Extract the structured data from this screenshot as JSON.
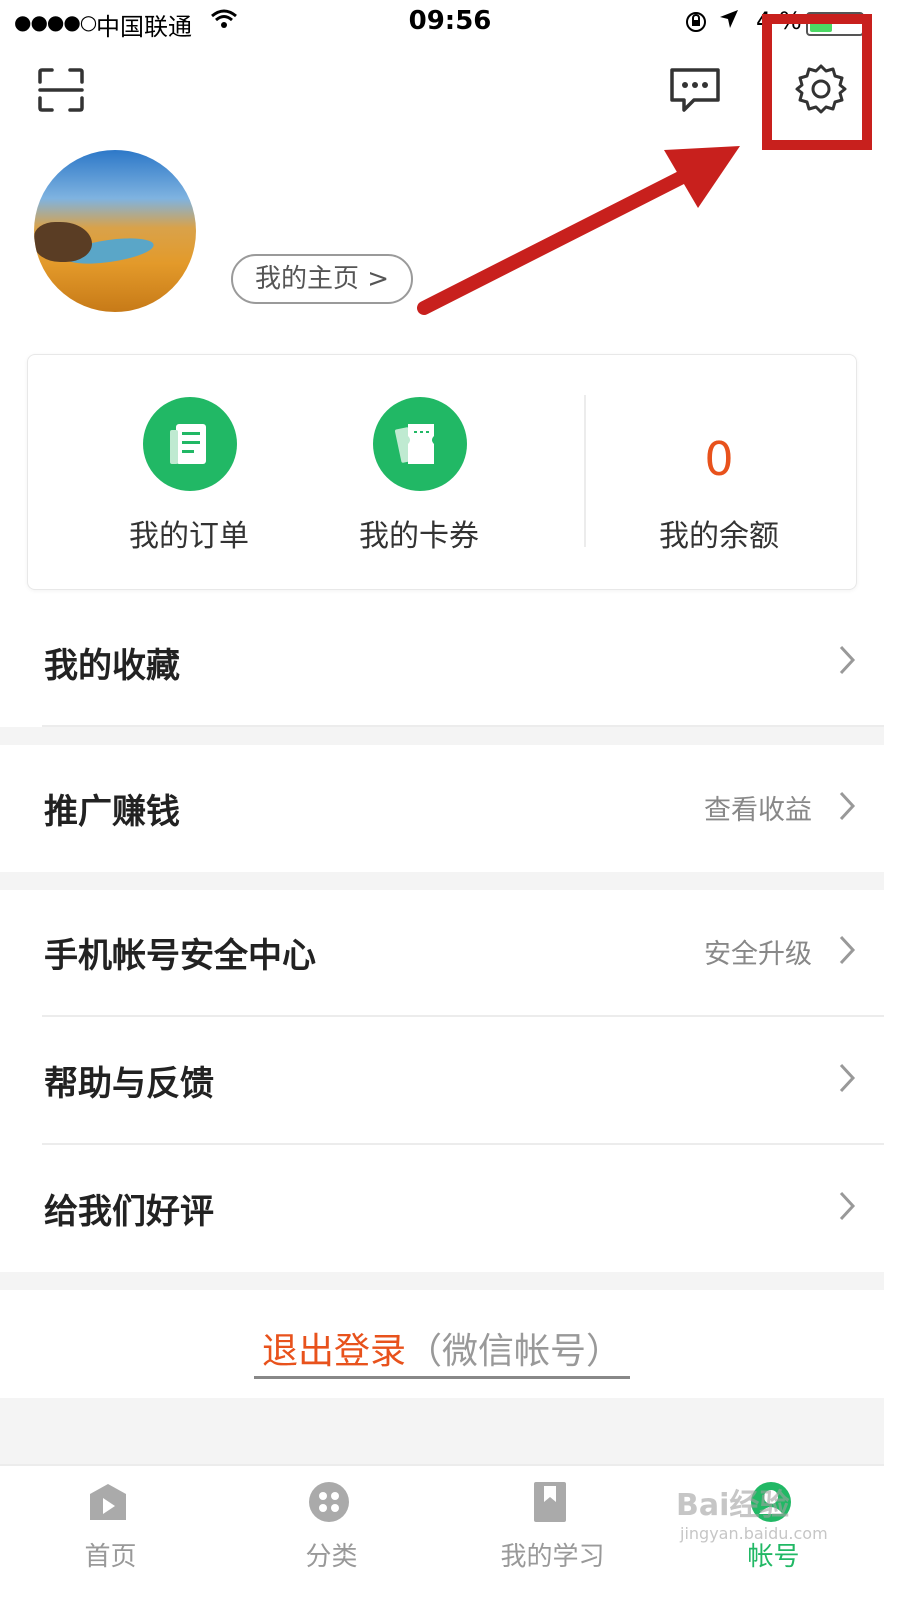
{
  "status_bar": {
    "signal": "●●●●○",
    "carrier": "中国联通",
    "time": "09:56",
    "battery_text": "4  %",
    "battery_level": 0.4
  },
  "header": {
    "scan_icon": "scan-icon",
    "message_icon": "message-icon",
    "settings_icon": "gear-icon"
  },
  "profile": {
    "home_button": "我的主页 >"
  },
  "stats": {
    "orders_label": "我的订单",
    "coupons_label": "我的卡券",
    "balance_value": "0",
    "balance_label": "我的余额"
  },
  "menu": {
    "favorites": "我的收藏",
    "promote": "推广赚钱",
    "promote_extra": "查看收益",
    "security": "手机帐号安全中心",
    "security_extra": "安全升级",
    "help": "帮助与反馈",
    "rate": "给我们好评"
  },
  "logout": {
    "action": "退出登录",
    "note": "（微信帐号）"
  },
  "tabs": [
    {
      "label": "首页",
      "icon": "play-icon"
    },
    {
      "label": "分类",
      "icon": "category-icon"
    },
    {
      "label": "我的学习",
      "icon": "bookmark-icon"
    },
    {
      "label": "帐号",
      "icon": "user-icon"
    }
  ],
  "watermark": {
    "text": "Bai经验",
    "sub": "jingyan.baidu.com"
  },
  "colors": {
    "accent_green": "#21b865",
    "orange": "#e8521c",
    "annotation_red": "#c8201d"
  }
}
